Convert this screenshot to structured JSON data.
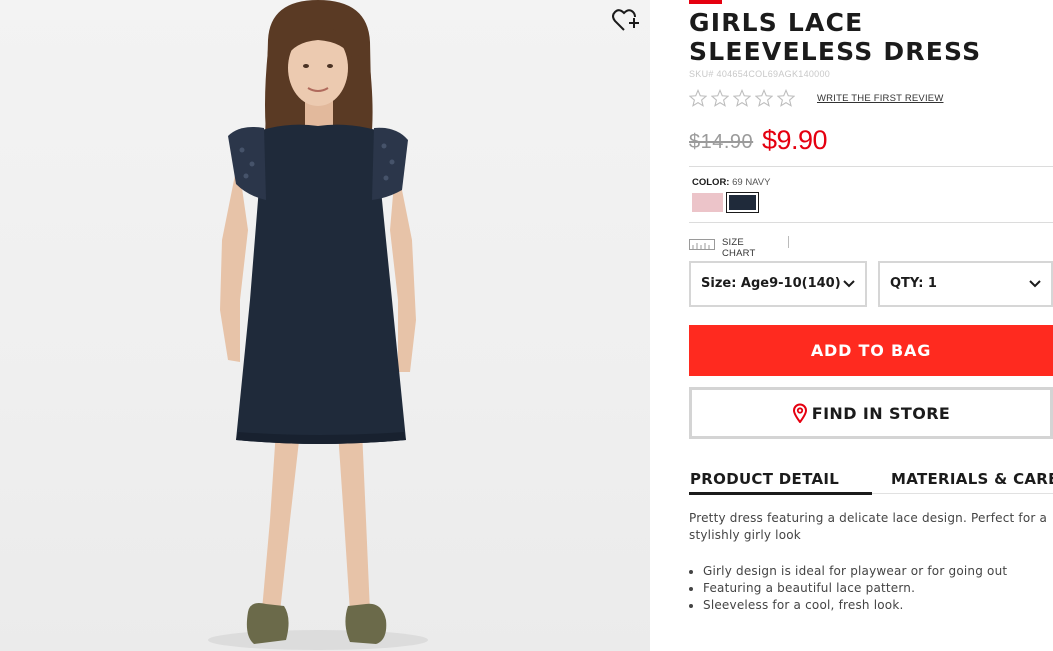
{
  "product": {
    "title": "GIRLS LACE SLEEVELESS DRESS",
    "sku": "SKU# 404654COL69AGK140000",
    "rating_stars": 0,
    "rating_max": 5,
    "review_link": "WRITE THE FIRST REVIEW",
    "price_original": "$14.90",
    "price_sale": "$9.90"
  },
  "color": {
    "label": "COLOR:",
    "selected": "69 NAVY",
    "swatches": [
      {
        "name": "pink",
        "hex": "#ecc4c9",
        "selected": false
      },
      {
        "name": "navy",
        "hex": "#1f2a3a",
        "selected": true
      }
    ]
  },
  "size_chart": {
    "label": "SIZE CHART",
    "icon": "ruler-icon"
  },
  "size_select": {
    "value": "Size: Age9-10(140)"
  },
  "qty_select": {
    "value": "QTY: 1"
  },
  "actions": {
    "add_to_bag": "ADD TO BAG",
    "find_in_store": "FIND IN STORE"
  },
  "tabs": [
    {
      "label": "PRODUCT DETAIL",
      "active": true
    },
    {
      "label": "MATERIALS & CARE",
      "active": false
    }
  ],
  "detail": {
    "description": "Pretty dress featuring a delicate lace design. Perfect for a stylishly girly look",
    "bullets": [
      "Girly design is ideal for playwear or for going out",
      "Featuring a beautiful lace pattern.",
      "Sleeveless for a cool, fresh look."
    ]
  },
  "colors": {
    "accent": "#e50010",
    "add_to_bag_bg": "#ff2a1f",
    "dress_navy": "#1f2a3a"
  },
  "icons": {
    "wishlist": "heart-plus-icon",
    "store": "map-pin-icon",
    "chevron": "chevron-down-icon",
    "star": "star-outline-icon"
  }
}
